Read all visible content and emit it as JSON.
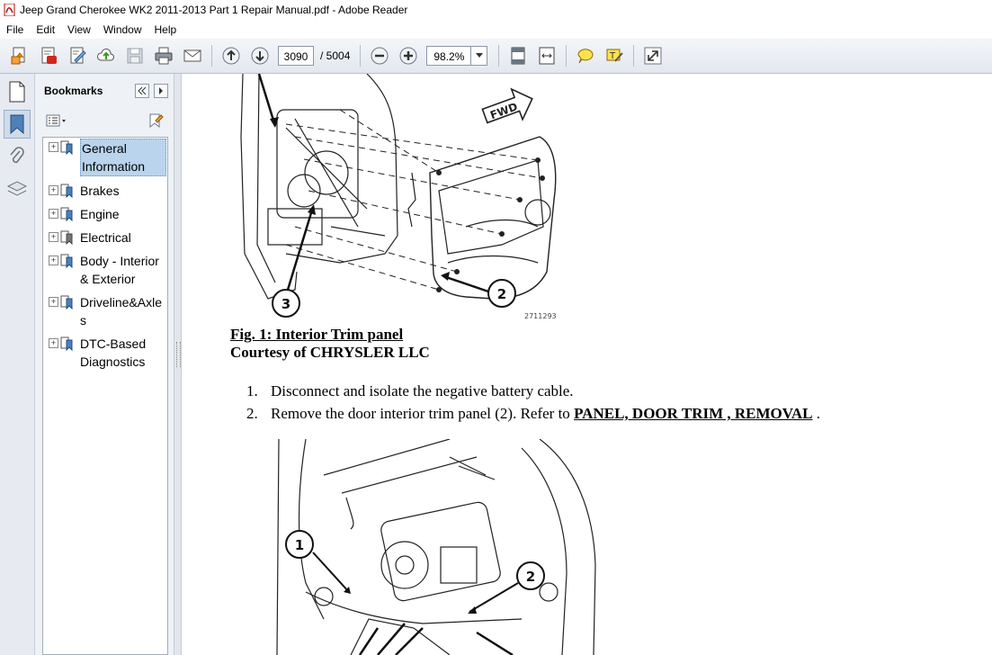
{
  "window": {
    "title": "Jeep Grand Cherokee WK2 2011-2013 Part 1 Repair Manual.pdf - Adobe Reader"
  },
  "menu": [
    "File",
    "Edit",
    "View",
    "Window",
    "Help"
  ],
  "toolbar": {
    "current_page": "3090",
    "total_pages": "/  5004",
    "zoom": "98.2%"
  },
  "bookmarks_panel": {
    "title": "Bookmarks",
    "items": [
      {
        "label": "General Information",
        "selected": true
      },
      {
        "label": "Brakes"
      },
      {
        "label": "Engine"
      },
      {
        "label": "Electrical"
      },
      {
        "label": "Body - Interior & Exterior"
      },
      {
        "label": "Driveline&Axles"
      },
      {
        "label": "DTC-Based Diagnostics"
      }
    ]
  },
  "document": {
    "figure1": {
      "caption": "Fig. 1: Interior Trim panel",
      "courtesy": "Courtesy of CHRYSLER LLC",
      "image_id": "2711293",
      "callouts": [
        "2",
        "3"
      ],
      "fwd_label": "FWD"
    },
    "steps": [
      {
        "num": "1.",
        "text": "Disconnect and isolate the negative battery cable."
      },
      {
        "num": "2.",
        "text": "Remove the door interior trim panel (2). Refer to ",
        "link": "PANEL, DOOR TRIM , REMOVAL",
        "suffix": " ."
      }
    ],
    "figure2": {
      "callouts": [
        "1",
        "2"
      ]
    }
  }
}
